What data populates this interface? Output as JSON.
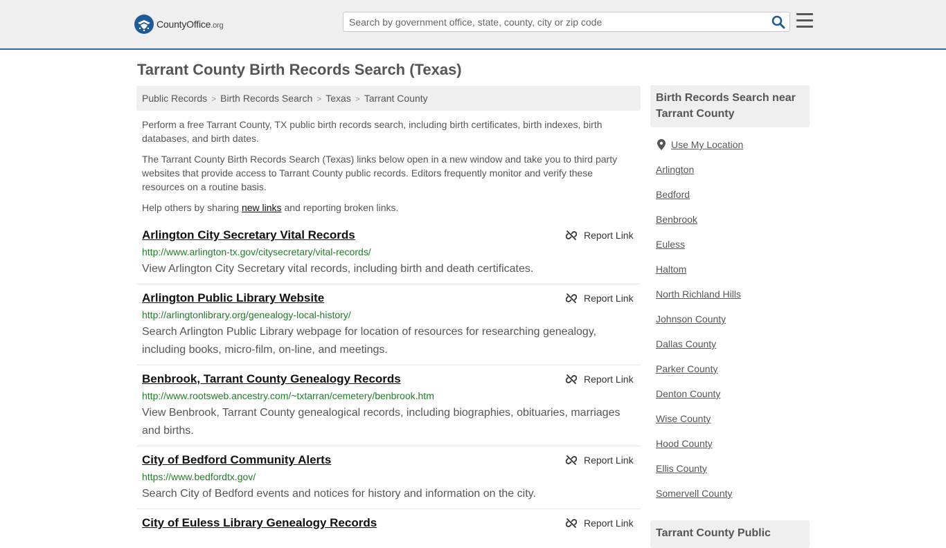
{
  "header": {
    "logo_main": "CountyOffice",
    "logo_suffix": ".org",
    "search_placeholder": "Search by government office, state, county, city or zip code"
  },
  "page": {
    "title": "Tarrant County Birth Records Search (Texas)"
  },
  "breadcrumb": [
    "Public Records",
    "Birth Records Search",
    "Texas",
    "Tarrant County"
  ],
  "intro": {
    "p1": "Perform a free Tarrant County, TX public birth records search, including birth certificates, birth indexes, birth databases, and birth dates.",
    "p2": "The Tarrant County Birth Records Search (Texas) links below open in a new window and take you to third party websites that provide access to Tarrant County public records. Editors frequently monitor and verify these resources on a routine basis.",
    "p3_before": "Help others by sharing ",
    "p3_link": "new links",
    "p3_after": " and reporting broken links."
  },
  "report_label": "Report Link",
  "results": [
    {
      "title": "Arlington City Secretary Vital Records",
      "url": "http://www.arlington-tx.gov/citysecretary/vital-records/",
      "desc": "View Arlington City Secretary vital records, including birth and death certificates."
    },
    {
      "title": "Arlington Public Library Website",
      "url": "http://arlingtonlibrary.org/genealogy-local-history/",
      "desc": "Search Arlington Public Library webpage for location of resources for researching genealogy, including books, micro-film, on-line, and meetings."
    },
    {
      "title": "Benbrook, Tarrant County Genealogy Records",
      "url": "http://www.rootsweb.ancestry.com/~txtarran/cemetery/benbrook.htm",
      "desc": "View Benbrook, Tarrant County genealogical records, including biographies, obituaries, marriages and births."
    },
    {
      "title": "City of Bedford Community Alerts",
      "url": "https://www.bedfordtx.gov/",
      "desc": "Search City of Bedford events and notices for history and information on the city."
    },
    {
      "title": "City of Euless Library Genealogy Records",
      "url": "",
      "desc": ""
    }
  ],
  "sidebar": {
    "heading": "Birth Records Search near Tarrant County",
    "use_location": "Use My Location",
    "links": [
      "Arlington",
      "Bedford",
      "Benbrook",
      "Euless",
      "Haltom",
      "North Richland Hills",
      "Johnson County",
      "Dallas County",
      "Parker County",
      "Denton County",
      "Wise County",
      "Hood County",
      "Ellis County",
      "Somervell County"
    ],
    "heading2": "Tarrant County Public"
  }
}
